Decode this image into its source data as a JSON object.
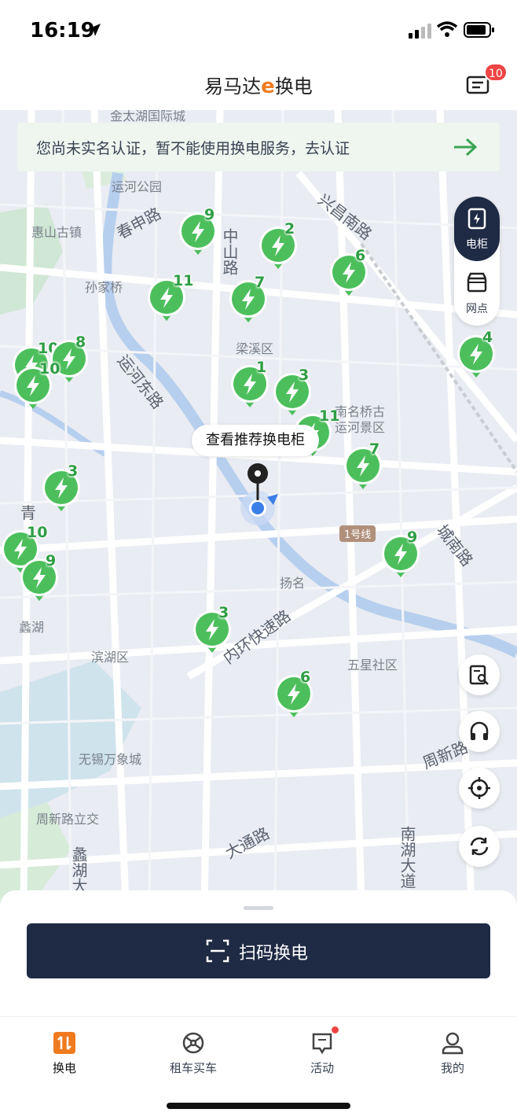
{
  "status": {
    "time": "16:19"
  },
  "header": {
    "title_prefix": "易马达",
    "title_e": "e",
    "title_suffix": "换电",
    "message_count": "10"
  },
  "banner": {
    "text": "您尚未实名认证，暂不能使用换电服务，去认证"
  },
  "toggle": {
    "cabinet": "电柜",
    "outlet": "网点"
  },
  "tooltip": {
    "text": "查看推荐换电柜"
  },
  "line_badge": "1号线",
  "map_labels": {
    "l1": "运河公园",
    "l2": "惠山古镇",
    "l3": "春申路",
    "l4": "中山路",
    "l5": "兴昌南路",
    "l6": "孙家桥",
    "l7": "梁溪区",
    "l8": "运河东路",
    "l9": "南名桥古",
    "l10": "运河景区",
    "l11": "扬名",
    "l12": "城南路",
    "l13": "内环快速路",
    "l14": "滨湖区",
    "l15": "五星社区",
    "l16": "蠡湖",
    "l17": "无锡万象城",
    "l18": "周新路立交",
    "l19": "大通路",
    "l20": "南湖大道",
    "l21": "周新路",
    "l22": "蠡湖大道",
    "l23": "青",
    "l24": "金太湖国际城"
  },
  "markers": [
    "9",
    "2",
    "6",
    "11",
    "7",
    "10",
    "8",
    "10",
    "1",
    "3",
    "4",
    "11",
    "7",
    "3",
    "9",
    "10",
    "9",
    "3",
    "6"
  ],
  "bottom": {
    "scan_label": "扫码换电"
  },
  "tabs": [
    {
      "label": "换电",
      "icon": "swap-icon",
      "active": true
    },
    {
      "label": "租车买车",
      "icon": "steering-wheel-icon"
    },
    {
      "label": "活动",
      "icon": "activity-icon",
      "dot": true
    },
    {
      "label": "我的",
      "icon": "profile-icon"
    }
  ],
  "colors": {
    "accent": "#1f2a44",
    "marker_green": "#4cbf5c",
    "brand_orange": "#f07b1f",
    "badge_red": "#ef4444"
  }
}
